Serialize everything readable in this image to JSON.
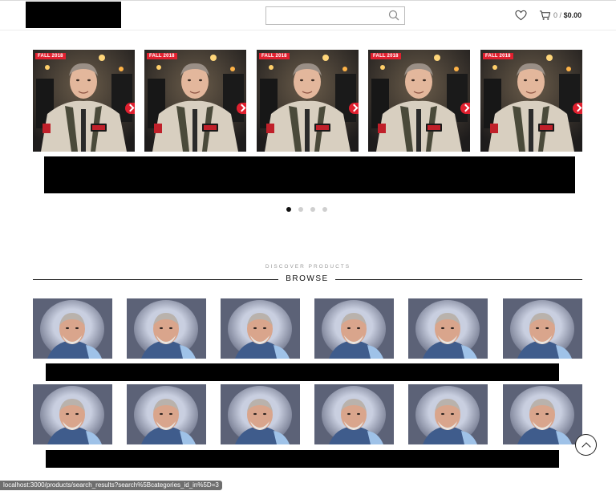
{
  "header": {
    "search": {
      "value": "",
      "placeholder": ""
    },
    "cart": {
      "count": "0",
      "separator": "/",
      "total": "$0.00"
    }
  },
  "featured": {
    "items": [
      {
        "badge": "FALL 2018"
      },
      {
        "badge": "FALL 2018"
      },
      {
        "badge": "FALL 2018"
      },
      {
        "badge": "FALL 2018"
      },
      {
        "badge": "FALL 2018"
      }
    ],
    "dots": 4,
    "active_dot": 0
  },
  "browse": {
    "eyebrow": "DISCOVER PRODUCTS",
    "title": "BROWSE",
    "row_count": 2,
    "items_per_row": 6
  },
  "status_bar": {
    "url": "localhost:3000/products/search_results?search%5Bcategories_id_in%5D=3"
  },
  "colors": {
    "badge": "#e0202f",
    "text": "#222222",
    "muted": "#9a9a9a"
  }
}
